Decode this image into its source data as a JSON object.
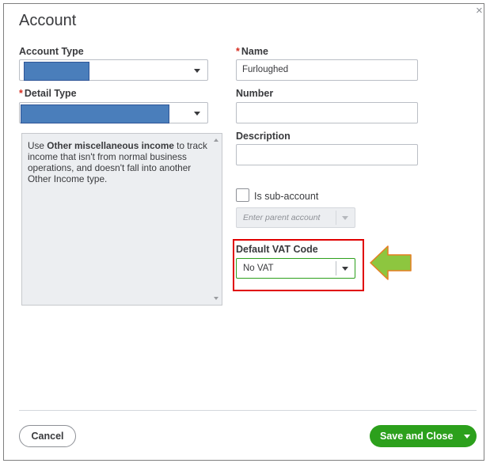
{
  "dialog": {
    "title": "Account",
    "close_glyph": "×"
  },
  "left": {
    "account_type_label": "Account Type",
    "detail_type_required": "*",
    "detail_type_label": "Detail Type",
    "description_parts": [
      "Use ",
      "Other miscellaneous income",
      " to track income that isn't from normal business operations, and doesn't fall into another Other Income type."
    ]
  },
  "right": {
    "name_required": "*",
    "name_label": "Name",
    "name_value": "Furloughed",
    "number_label": "Number",
    "number_value": "",
    "description_label": "Description",
    "description_value": "",
    "subaccount_label": "Is sub-account",
    "parent_placeholder": "Enter parent account",
    "vat_label": "Default VAT Code",
    "vat_value": "No VAT"
  },
  "footer": {
    "cancel_label": "Cancel",
    "save_label": "Save and Close"
  },
  "annotation": {
    "arrow_color": "#8dc63f",
    "highlight_color": "#e00000",
    "redaction_color": "#4a7ebb"
  }
}
